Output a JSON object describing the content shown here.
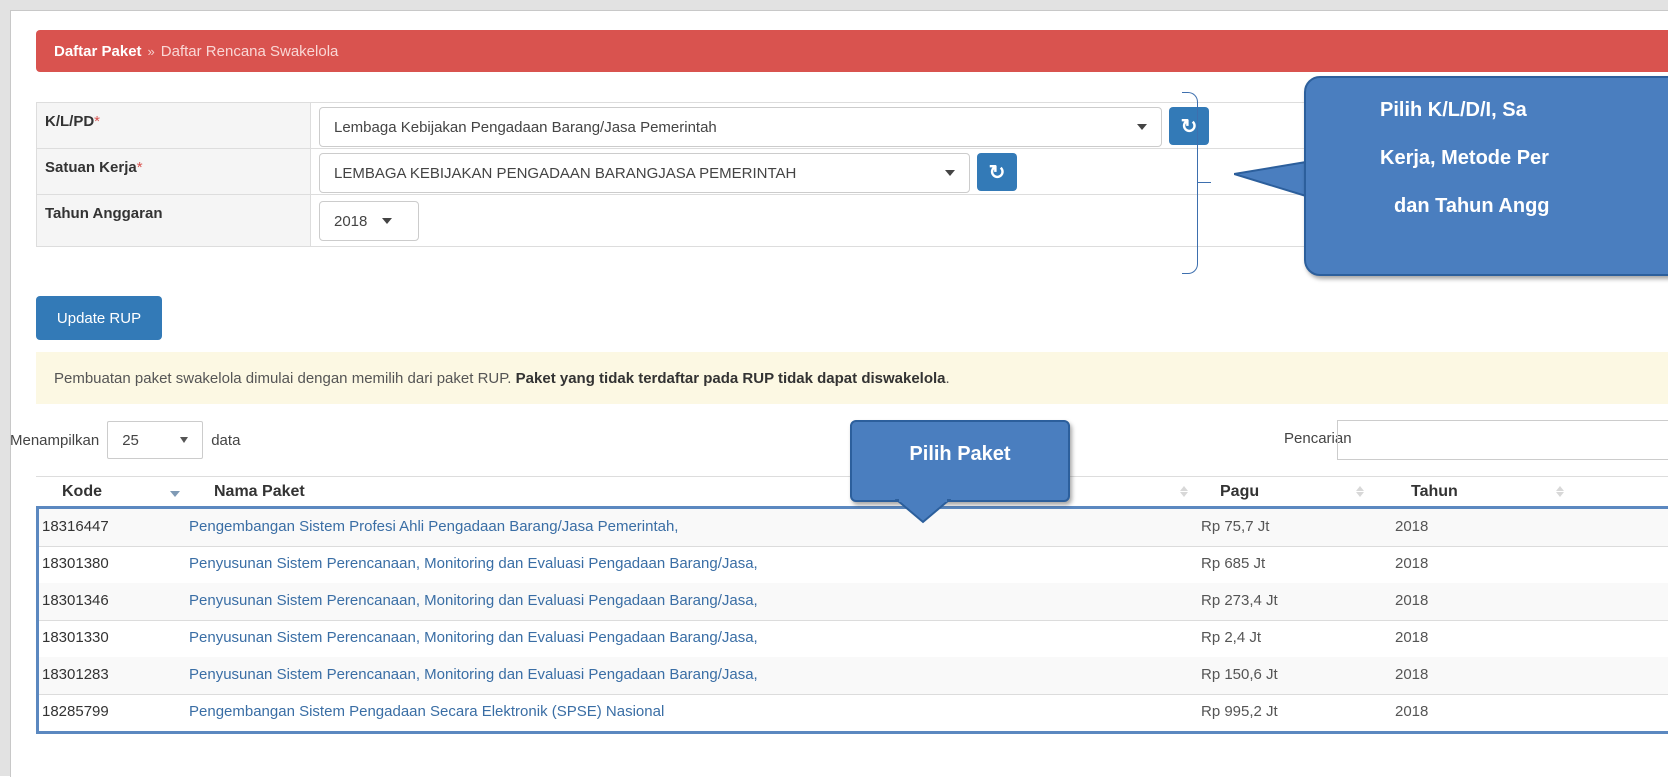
{
  "breadcrumb": {
    "parent": "Daftar Paket",
    "separator": "»",
    "current": "Daftar Rencana Swakelola"
  },
  "form": {
    "klpd": {
      "label": "K/L/PD",
      "required_mark": "*",
      "value": "Lembaga Kebijakan Pengadaan Barang/Jasa Pemerintah"
    },
    "satuan_kerja": {
      "label": "Satuan Kerja",
      "required_mark": "*",
      "value": "LEMBAGA KEBIJAKAN PENGADAAN BARANGJASA PEMERINTAH"
    },
    "tahun_anggaran": {
      "label": "Tahun Anggaran",
      "value": "2018"
    }
  },
  "update_button": "Update RUP",
  "alert": {
    "text": "Pembuatan paket swakelola dimulai dengan memilih dari paket RUP.",
    "bold": "Paket yang tidak terdaftar pada RUP tidak dapat diswakelola",
    "end": "."
  },
  "table_controls": {
    "show_prefix": "Menampilkan",
    "page_size": "25",
    "show_suffix": "data",
    "search_label": "Pencarian"
  },
  "callouts": {
    "filter_lines": [
      "Pilih K/L/D/I, Sa",
      "Kerja, Metode Per",
      "dan Tahun Angg"
    ],
    "package": "Pilih Paket"
  },
  "table": {
    "headers": {
      "kode": "Kode",
      "nama": "Nama Paket",
      "pagu": "Pagu",
      "tahun": "Tahun"
    },
    "rows": [
      {
        "kode": "18316447",
        "nama": "Pengembangan Sistem Profesi Ahli Pengadaan Barang/Jasa Pemerintah,",
        "pagu": "Rp 75,7 Jt",
        "tahun": "2018"
      },
      {
        "kode": "18301380",
        "nama": "Penyusunan Sistem Perencanaan, Monitoring dan Evaluasi Pengadaan Barang/Jasa,",
        "pagu": "Rp 685 Jt",
        "tahun": "2018"
      },
      {
        "kode": "18301346",
        "nama": "Penyusunan Sistem Perencanaan, Monitoring dan Evaluasi Pengadaan Barang/Jasa,",
        "pagu": "Rp 273,4 Jt",
        "tahun": "2018"
      },
      {
        "kode": "18301330",
        "nama": "Penyusunan Sistem Perencanaan, Monitoring dan Evaluasi Pengadaan Barang/Jasa,",
        "pagu": "Rp 2,4 Jt",
        "tahun": "2018"
      },
      {
        "kode": "18301283",
        "nama": "Penyusunan Sistem Perencanaan, Monitoring dan Evaluasi Pengadaan Barang/Jasa,",
        "pagu": "Rp 150,6 Jt",
        "tahun": "2018"
      },
      {
        "kode": "18285799",
        "nama": "Pengembangan Sistem Pengadaan Secara Elektronik (SPSE) Nasional",
        "pagu": "Rp 995,2 Jt",
        "tahun": "2018"
      }
    ]
  },
  "colors": {
    "breadcrumb_bg": "#d9534f",
    "primary_button": "#337ab7",
    "callout": "#4a7ebf",
    "link": "#3a6ea5",
    "alert_bg": "#fcf8e3"
  }
}
